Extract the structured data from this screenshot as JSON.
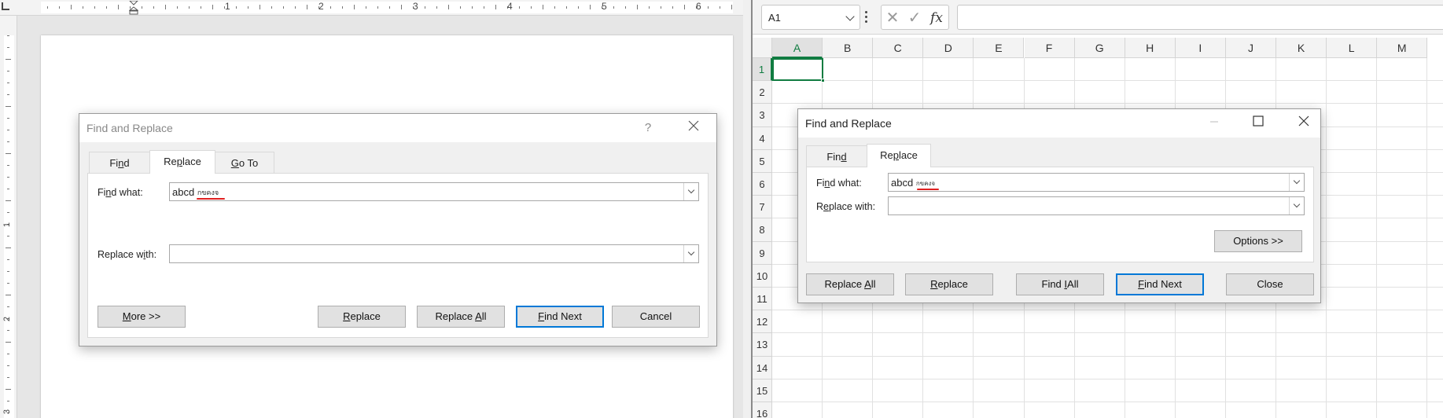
{
  "word": {
    "ruler_numbers": [
      "1",
      "2",
      "3",
      "4",
      "5",
      "6"
    ],
    "left_ruler_numbers": [
      "1",
      "2",
      "3"
    ],
    "dialog": {
      "title": "Find and Replace",
      "help_icon": "?",
      "close_icon": "close-icon",
      "tabs": [
        {
          "pre": "Fi",
          "acc": "n",
          "post": "d",
          "active": false
        },
        {
          "pre": "Re",
          "acc": "p",
          "post": "lace",
          "active": true
        },
        {
          "pre": "",
          "acc": "G",
          "post": "o To",
          "active": false
        }
      ],
      "find_label": {
        "pre": "Fi",
        "acc": "n",
        "post": "d what:"
      },
      "find_value": "abcd",
      "find_value_thai": "กขคงจ",
      "replace_label": {
        "pre": "Replace w",
        "acc": "i",
        "post": "th:"
      },
      "replace_value": "",
      "buttons": {
        "more": {
          "pre": "",
          "acc": "M",
          "post": "ore >>"
        },
        "replace": {
          "pre": "",
          "acc": "R",
          "post": "eplace"
        },
        "replace_all": {
          "pre": "Replace ",
          "acc": "A",
          "post": "ll"
        },
        "find_next": {
          "pre": "",
          "acc": "F",
          "post": "ind Next"
        },
        "cancel": "Cancel"
      }
    }
  },
  "excel": {
    "name_box": "A1",
    "formula": "",
    "columns": [
      "A",
      "B",
      "C",
      "D",
      "E",
      "F",
      "G",
      "H",
      "I",
      "J",
      "K",
      "L",
      "M"
    ],
    "rows": [
      "1",
      "2",
      "3",
      "4",
      "5",
      "6",
      "7",
      "8",
      "9",
      "10",
      "11",
      "12",
      "13",
      "14",
      "15",
      "16"
    ],
    "selected_column": "A",
    "selected_row": "1",
    "dialog": {
      "title": "Find and Replace",
      "tabs": [
        {
          "pre": "Fin",
          "acc": "d",
          "post": "",
          "active": false
        },
        {
          "pre": "Re",
          "acc": "p",
          "post": "lace",
          "active": true
        }
      ],
      "find_label": {
        "pre": "Fi",
        "acc": "n",
        "post": "d what:"
      },
      "find_value": "abcd",
      "find_value_thai": "กขคงจ",
      "replace_label": {
        "pre": "R",
        "acc": "e",
        "post": "place with:"
      },
      "replace_value": "",
      "buttons": {
        "options": "Options >>",
        "replace_all": {
          "pre": "Replace ",
          "acc": "A",
          "post": "ll"
        },
        "replace": {
          "pre": "",
          "acc": "R",
          "post": "eplace"
        },
        "find_all": {
          "pre": "Find ",
          "acc": "I",
          "post": "All"
        },
        "find_next": {
          "pre": "",
          "acc": "F",
          "post": "ind Next"
        },
        "close": "Close"
      }
    }
  }
}
